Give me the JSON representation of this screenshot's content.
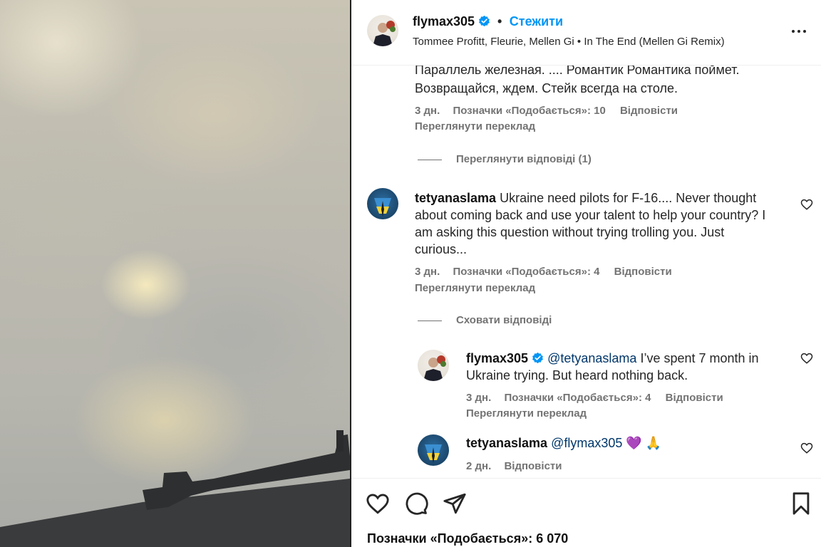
{
  "post": {
    "username": "flymax305",
    "follow_label": "Стежити",
    "separator": "•",
    "music": "Tommee Profitt, Fleurie, Mellen Gi • In The End (Mellen Gi Remix)",
    "more_icon": "more-options-icon",
    "likes_total": "Позначки «Подобається»: 6 070"
  },
  "comments": [
    {
      "text_line1": "Параллель железная. .... Романтик Романтика поймет.",
      "text_line2": "Возвращайся, ждем. Стейк всегда на столе.",
      "time": "3 дн.",
      "likes": "Позначки «Подобається»: 10",
      "reply": "Відповісти",
      "translate": "Переглянути переклад",
      "replies_toggle": "Переглянути відповіді (1)"
    },
    {
      "username": "tetyanaslama",
      "text_line1": "Ukraine need pilots for F-16.... Never thought",
      "text_line2": "about coming back and use your talent to help your country? I",
      "text_line3": "am asking this question without trying trolling you. Just",
      "text_line4": "curious...",
      "time": "3 дн.",
      "likes": "Позначки «Подобається»: 4",
      "reply": "Відповісти",
      "translate": "Переглянути переклад",
      "replies_toggle": "Сховати відповіді"
    }
  ],
  "replies": [
    {
      "username": "flymax305",
      "mention": "@tetyanaslama",
      "text_line1": "I’ve spent 7 month in",
      "text_line2": "Ukraine trying. But heard nothing back.",
      "time": "3 дн.",
      "likes": "Позначки «Подобається»: 4",
      "reply": "Відповісти",
      "translate": "Переглянути переклад"
    },
    {
      "username": "tetyanaslama",
      "mention": "@flymax305",
      "emoji": "💜 🙏",
      "time": "2 дн.",
      "reply": "Відповісти"
    }
  ],
  "colors": {
    "link_blue": "#0095f6",
    "verified_blue": "#0095f6",
    "meta_gray": "#737373"
  }
}
